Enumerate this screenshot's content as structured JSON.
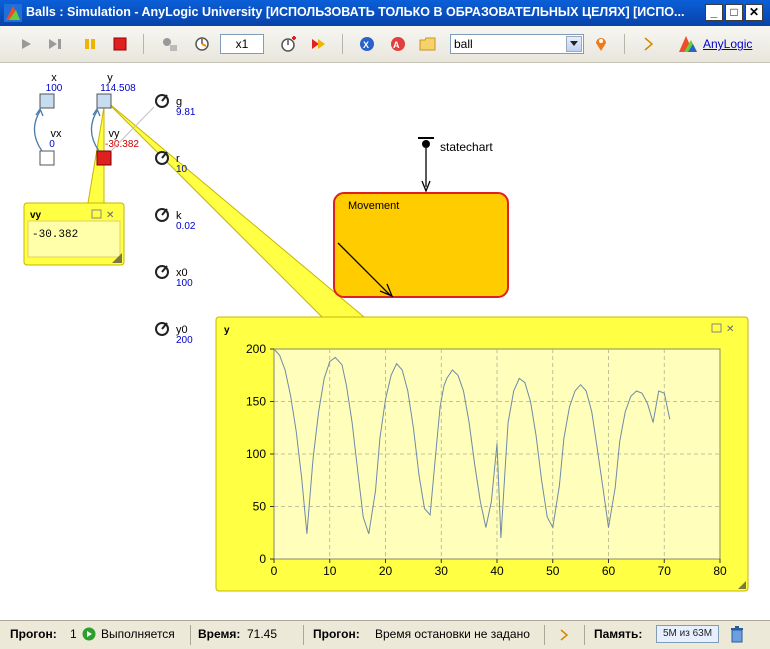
{
  "window": {
    "title": "Balls : Simulation - AnyLogic University  [ИСПОЛЬЗОВАТЬ ТОЛЬКО В ОБРАЗОВАТЕЛЬНЫХ ЦЕЛЯХ] [ИСПО...",
    "minimize": "_",
    "maximize": "□",
    "close": "✕"
  },
  "toolbar": {
    "speed": "x1",
    "search_value": "ball",
    "brand_link": "AnyLogic"
  },
  "model": {
    "variables": {
      "x": {
        "label": "x",
        "value": "100"
      },
      "y": {
        "label": "y",
        "value": "114.508"
      },
      "vx": {
        "label": "vx",
        "value": "0"
      },
      "vy": {
        "label": "vy",
        "value": "-30.382"
      }
    },
    "parameters": [
      {
        "label": "g",
        "value": "9.81"
      },
      {
        "label": "r",
        "value": "10"
      },
      {
        "label": "k",
        "value": "0.02"
      },
      {
        "label": "x0",
        "value": "100"
      },
      {
        "label": "y0",
        "value": "200"
      }
    ],
    "statechart": {
      "label": "statechart",
      "state": "Movement"
    },
    "inspect_vy": {
      "title": "vy",
      "value": "-30.382"
    },
    "colors": {
      "param_value": "#0000cc",
      "vy_value": "#d00000",
      "inspect_bg": "#ffff44",
      "state_fill": "#ffcc00",
      "state_border": "#e02020"
    }
  },
  "chart_data": {
    "type": "line",
    "title": "y",
    "xlim": [
      0,
      80
    ],
    "ylim": [
      0,
      200
    ],
    "xticks": [
      0,
      10,
      20,
      30,
      40,
      50,
      60,
      70,
      80
    ],
    "yticks": [
      0,
      50,
      100,
      150,
      200
    ],
    "grid": true,
    "series": [
      {
        "x": [
          0,
          1,
          2,
          3,
          4,
          5,
          5.9,
          7,
          8,
          9,
          10,
          11,
          12.2,
          13,
          14,
          15,
          16,
          17,
          18.2,
          19,
          20,
          21,
          22,
          23,
          24,
          25,
          26,
          27,
          28,
          29,
          29.8,
          30.5,
          31,
          32,
          33,
          34,
          35,
          36,
          37,
          38,
          39,
          40,
          40.7,
          41.5,
          42,
          43,
          44,
          45,
          46,
          47,
          48,
          49,
          50,
          51.2,
          52,
          53,
          54,
          55,
          56,
          57,
          58,
          59,
          60,
          61.2,
          62,
          63,
          64,
          65,
          66,
          67,
          68,
          69,
          70,
          71
        ],
        "y": [
          200,
          194,
          180,
          155,
          121,
          75,
          24,
          95,
          140,
          172,
          188,
          192,
          185,
          165,
          130,
          85,
          40,
          24,
          65,
          115,
          152,
          175,
          186,
          180,
          160,
          125,
          80,
          48,
          42,
          100,
          145,
          165,
          172,
          180,
          175,
          160,
          130,
          90,
          55,
          30,
          55,
          110,
          20,
          90,
          130,
          160,
          172,
          168,
          150,
          118,
          75,
          40,
          30,
          70,
          115,
          145,
          160,
          166,
          160,
          140,
          105,
          68,
          30,
          68,
          112,
          140,
          155,
          160,
          158,
          148,
          130,
          160,
          158,
          133
        ]
      }
    ]
  },
  "status": {
    "run_label": "Прогон:",
    "run_number": "1",
    "run_state": "Выполняется",
    "time_label": "Время:",
    "time_value": "71.45",
    "stop_label": "Прогон:",
    "stop_value": "Время остановки не задано",
    "memory_label": "Память:",
    "memory_value": "5М из 63М"
  }
}
